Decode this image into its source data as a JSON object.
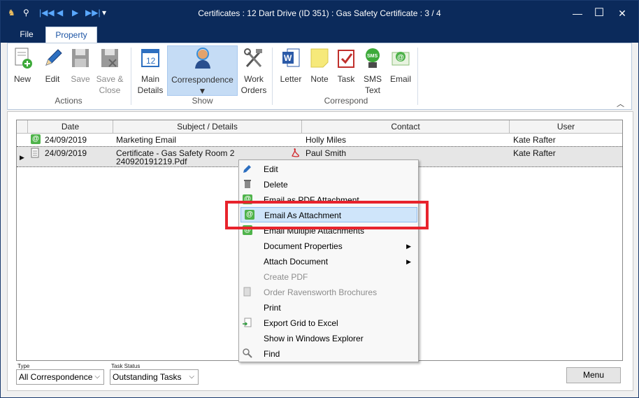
{
  "window": {
    "title": "Certificates : 12 Dart Drive (ID 351) : Gas Safety Certificate : 3 / 4",
    "controls": {
      "minimize": "—",
      "maximize": "☐",
      "close": "✕"
    }
  },
  "qat": [
    "|◀◀",
    "◀",
    "▶",
    "▶▶|",
    "▾"
  ],
  "ribbon": {
    "tabs": [
      "File",
      "Property"
    ],
    "active_tab": "Property",
    "groups": [
      {
        "label": "Actions",
        "buttons": [
          {
            "label": "New",
            "icon": "new-document-icon"
          },
          {
            "label": "Edit",
            "icon": "pencil-icon"
          },
          {
            "label": "Save",
            "icon": "floppy-disk-icon",
            "disabled": true
          },
          {
            "label": "Save & Close",
            "icon": "save-close-icon",
            "disabled": true
          }
        ]
      },
      {
        "label": "Show",
        "buttons": [
          {
            "label": "Main Details",
            "icon": "calendar-icon"
          },
          {
            "label": "Correspondence",
            "icon": "person-icon",
            "active": true
          },
          {
            "label": "Work Orders",
            "icon": "tools-icon"
          }
        ]
      },
      {
        "label": "Correspond",
        "buttons": [
          {
            "label": "Letter",
            "icon": "word-icon"
          },
          {
            "label": "Note",
            "icon": "sticky-note-icon"
          },
          {
            "label": "Task",
            "icon": "checkbox-icon"
          },
          {
            "label": "SMS Text",
            "icon": "sms-icon"
          },
          {
            "label": "Email",
            "icon": "email-icon"
          }
        ]
      }
    ],
    "b_new": "New",
    "b_edit": "Edit",
    "b_save": "Save",
    "b_save_close_1": "Save &",
    "b_save_close_2": "Close",
    "b_main_1": "Main",
    "b_main_2": "Details",
    "b_corr": "Correspondence",
    "b_corr_arrow": "▼",
    "b_work_1": "Work",
    "b_work_2": "Orders",
    "b_letter": "Letter",
    "b_note": "Note",
    "b_task": "Task",
    "b_sms_1": "SMS",
    "b_sms_2": "Text",
    "b_email": "Email",
    "g_actions": "Actions",
    "g_show": "Show",
    "g_correspond": "Correspond",
    "collapse": "︿"
  },
  "grid": {
    "headers": [
      "Date",
      "Subject / Details",
      "Contact",
      "User"
    ],
    "rows": [
      {
        "icon": "email-icon",
        "date": "24/09/2019",
        "subject": "Marketing Email",
        "subject2": "",
        "contact": "Holly Miles",
        "user": "Kate Rafter",
        "selected": false
      },
      {
        "icon": "document-icon",
        "date": "24/09/2019",
        "subject": "Certificate - Gas Safety Room 2",
        "subject2": "240920191219.Pdf",
        "contact": "Paul Smith",
        "user": "Kate Rafter",
        "selected": true
      }
    ],
    "row_pointer": "▶",
    "pdf_icon": "pdf-icon"
  },
  "context_menu": {
    "items": [
      {
        "label": "Edit",
        "icon": "pencil-icon"
      },
      {
        "label": "Delete",
        "icon": "trash-icon"
      },
      {
        "label": "Email as PDF Attachment",
        "icon": "email-icon"
      },
      {
        "label": "Email As Attachment",
        "icon": "email-icon",
        "highlighted": true
      },
      {
        "label": "Email Multiple Attachments",
        "icon": "email-icon"
      },
      {
        "label": "Document Properties",
        "submenu": true
      },
      {
        "label": "Attach Document",
        "submenu": true
      },
      {
        "label": "Create PDF",
        "disabled": true
      },
      {
        "label": "Order Ravensworth Brochures",
        "icon": "brochure-icon",
        "disabled": true
      },
      {
        "label": "Print"
      },
      {
        "label": "Export Grid to Excel",
        "icon": "export-icon"
      },
      {
        "label": "Show in Windows Explorer"
      },
      {
        "label": "Find",
        "icon": "magnifier-icon"
      }
    ],
    "submenu_arrow": "▶"
  },
  "filters": {
    "type_label": "Type",
    "type_value": "All Correspondence",
    "status_label": "Task Status",
    "status_value": "Outstanding Tasks",
    "arrow": "⌵"
  },
  "menu_button": "Menu",
  "colors": {
    "titlebar": "#0b2a5b",
    "accent": "#1d55a5",
    "highlight_box": "#e8232c",
    "selection": "#cfe5fa"
  }
}
